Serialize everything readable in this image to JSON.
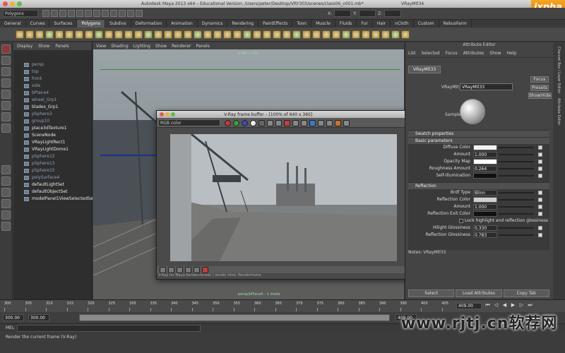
{
  "titlebar": {
    "title": "Autodesk Maya 2013 x64 – Educational Version: /Users/peter/Desktop/VRY303/scenes/class06_v001.mb*",
    "right_title": "VRayMtl34",
    "logo": "ixpha"
  },
  "status": {
    "mode": "Polygons",
    "xyz": [
      "X:",
      "Y:",
      "Z:"
    ]
  },
  "shelf": {
    "tabs": [
      "General",
      "Curves",
      "Surfaces",
      "Polygons",
      "Subdivs",
      "Deformation",
      "Animation",
      "Dynamics",
      "Rendering",
      "PaintEffects",
      "Toon",
      "Muscle",
      "Fluids",
      "Fur",
      "Hair",
      "nCloth",
      "Custom",
      "RebusFarm"
    ],
    "active_tab": "Polygons"
  },
  "outliner": {
    "menu": [
      "Display",
      "Show",
      "Panels"
    ],
    "items": [
      {
        "label": "persp",
        "bright": false
      },
      {
        "label": "top",
        "bright": false
      },
      {
        "label": "front",
        "bright": false
      },
      {
        "label": "side",
        "bright": false
      },
      {
        "label": "bPlane4",
        "bright": false
      },
      {
        "label": "wheel_Grp1",
        "bright": false
      },
      {
        "label": "blades_Grp1",
        "bright": true
      },
      {
        "label": "pSphere3",
        "bright": false
      },
      {
        "label": "group10",
        "bright": false
      },
      {
        "label": "place3dTexture1",
        "bright": true
      },
      {
        "label": "SceneNode",
        "bright": true
      },
      {
        "label": "VRayLightRect1",
        "bright": true
      },
      {
        "label": "VRayLightDome1",
        "bright": true
      },
      {
        "label": "pSphere12",
        "bright": false
      },
      {
        "label": "pSphere13",
        "bright": false
      },
      {
        "label": "pSphere15",
        "bright": false
      },
      {
        "label": "polySurface4",
        "bright": false
      },
      {
        "label": "defaultLightSet",
        "bright": true
      },
      {
        "label": "defaultObjectSet",
        "bright": true
      },
      {
        "label": "modelPanel1ViewSelectedSet",
        "bright": true
      }
    ]
  },
  "viewport": {
    "menu": [
      "View",
      "Shading",
      "Lighting",
      "Show",
      "Renderer",
      "Panels"
    ],
    "resolution": "1280 x 720",
    "bottom_label": "persp/bPlane5 : 1 mode"
  },
  "vfb": {
    "title": "V-Ray frame buffer – [100% of 640 x 360]",
    "channel": "RGB color",
    "status": "V-Ray for Maya Renderversion | render time: Renderframe"
  },
  "attribute_editor": {
    "header": "Attribute Editor",
    "menu": [
      "List",
      "Selected",
      "Focus",
      "Attributes",
      "Show",
      "Help"
    ],
    "tab": "VRayMtl33",
    "mtl_label": "VRayMtl:",
    "mtl_name": "VRayMtl33",
    "buttons": {
      "focus": "Focus",
      "presets": "Presets",
      "show": "Show",
      "hide": "Hide"
    },
    "sample_label": "Sample",
    "sections": {
      "swatch": "Swatch properties",
      "basic": "Basic parameters",
      "reflection": "Reflection"
    },
    "basic_rows": [
      {
        "label": "Diffuse Color",
        "kind": "swatch",
        "color": "#f2f2f2"
      },
      {
        "label": "Amount",
        "kind": "value",
        "value": "1.000"
      },
      {
        "label": "Opacity Map",
        "kind": "swatch",
        "color": "#ffffff"
      },
      {
        "label": "Roughness Amount",
        "kind": "value",
        "value": "0.264"
      },
      {
        "label": "Self-Illumination",
        "kind": "swatch",
        "color": "#111111"
      }
    ],
    "reflection_rows": [
      {
        "label": "Brdf Type",
        "kind": "value",
        "value": "Blinn"
      },
      {
        "label": "Reflection Color",
        "kind": "swatch",
        "color": "#d0d0d0"
      },
      {
        "label": "Amount",
        "kind": "value",
        "value": "1.000"
      },
      {
        "label": "Reflection Exit Color",
        "kind": "swatch",
        "color": "#111111"
      },
      {
        "label": "Lock highlight and reflection glossiness",
        "kind": "check"
      },
      {
        "label": "Hilight Glossiness",
        "kind": "value",
        "value": "0.330"
      },
      {
        "label": "Reflection Glossiness",
        "kind": "value",
        "value": "0.783"
      }
    ],
    "notes_label": "Notes: VRayMtl33",
    "bottom_buttons": [
      "Select",
      "Load Attributes",
      "Copy Tab"
    ]
  },
  "side_tabs": [
    "Channel Box / Layer Editor",
    "Attribute Editor"
  ],
  "timeline": {
    "ticks": [
      "300",
      "305",
      "310",
      "315",
      "320",
      "325",
      "330",
      "335",
      "340",
      "345",
      "350",
      "355",
      "360",
      "365",
      "370",
      "375",
      "380",
      "385",
      "390",
      "395",
      "400",
      "405"
    ],
    "current_frame": "409.00",
    "range_start": "300.00",
    "range_start2": "300.00",
    "range_end": "409.00"
  },
  "command": {
    "mel_label": "MEL"
  },
  "help": {
    "text": "Render the current frame (V-Ray)"
  },
  "watermark": "www.rjtj.cn软荐网"
}
